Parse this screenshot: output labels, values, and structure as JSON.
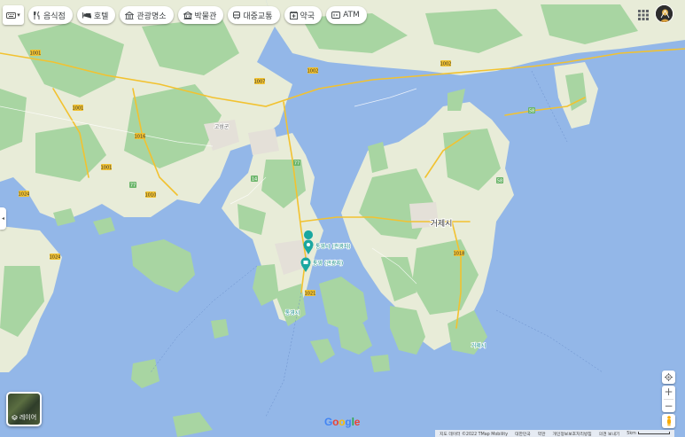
{
  "colors": {
    "water": "#93b7e8",
    "land": "#e8ecd8",
    "green": "#a8d5a2",
    "urban": "#e4e0d8",
    "road": "#f2c230",
    "poi_teal": "#19a7a0"
  },
  "toolbar": {
    "keyboard_icon": "keyboard-icon",
    "chips": [
      {
        "label": "음식점",
        "icon": "restaurant-icon"
      },
      {
        "label": "호텔",
        "icon": "hotel-icon"
      },
      {
        "label": "관광명소",
        "icon": "attraction-icon"
      },
      {
        "label": "박물관",
        "icon": "museum-icon"
      },
      {
        "label": "대중교통",
        "icon": "transit-icon"
      },
      {
        "label": "약국",
        "icon": "pharmacy-icon"
      },
      {
        "label": "ATM",
        "icon": "atm-icon"
      }
    ]
  },
  "map": {
    "city_label": "거제시",
    "poi_1": "통영시 (관광지)",
    "poi_2": "통영 (관광지)",
    "small_labels": [
      "고성군",
      "통영시",
      "거제시"
    ],
    "road_numbers": [
      "1001",
      "1002",
      "1007",
      "1008",
      "1010",
      "1016",
      "1018",
      "1021",
      "1024",
      "77",
      "14",
      "58",
      "5"
    ]
  },
  "layers": {
    "label": "레이어"
  },
  "footer": {
    "attribution": "지도 데이터 ©2022 TMap Mobility",
    "country": "대한민국",
    "terms": "약관",
    "privacy": "개인정보보호처리방침",
    "feedback": "의견 보내기",
    "scale": "5km"
  },
  "logo": "Google"
}
